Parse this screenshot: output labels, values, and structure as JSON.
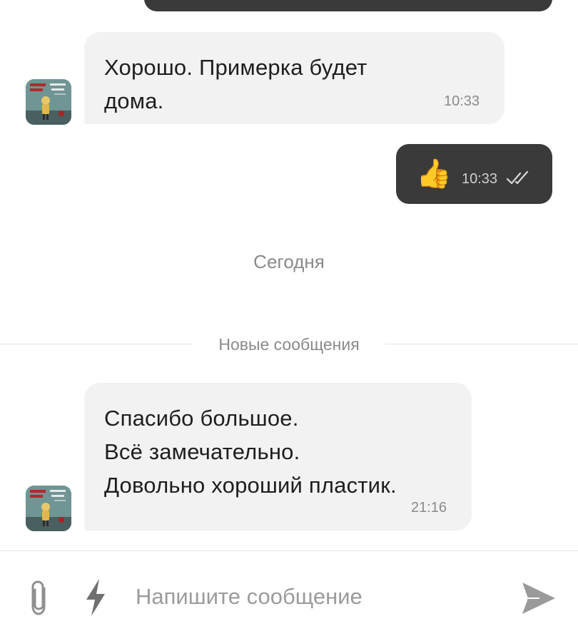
{
  "messages": [
    {
      "direction": "incoming",
      "text": "Хорошо. Примерка будет\nдома.",
      "time": "10:33"
    },
    {
      "direction": "outgoing",
      "emoji": "👍",
      "time": "10:33",
      "status_icon": "double-check-icon"
    },
    {
      "direction": "incoming",
      "text": "Спасибо большое.\nВсё замечательно.\nДовольно хороший пластик.",
      "time": "21:16"
    }
  ],
  "date_separator": "Сегодня",
  "new_messages_label": "Новые сообщения",
  "composer": {
    "placeholder": "Напишите сообщение",
    "attach_icon": "paperclip-icon",
    "quick_reply_icon": "lightning-icon",
    "send_icon": "send-icon"
  },
  "colors": {
    "incoming_bubble": "#f2f2f2",
    "outgoing_bubble": "#3a3a3a",
    "meta_text": "#8a8a8a"
  }
}
